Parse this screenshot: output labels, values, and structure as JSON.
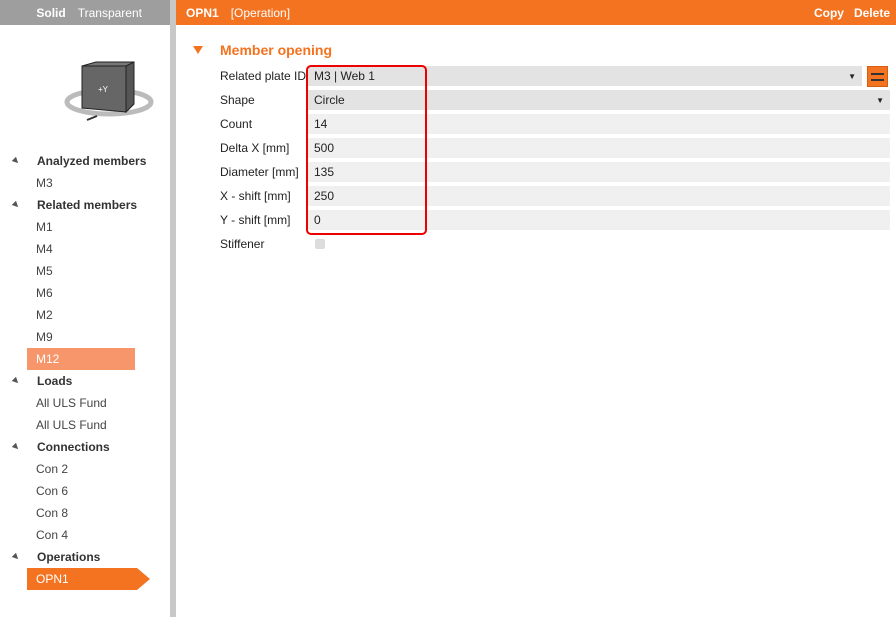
{
  "left_header": {
    "solid": "Solid",
    "transparent": "Transparent"
  },
  "tree": [
    {
      "type": "grp",
      "label": "Analyzed members"
    },
    {
      "type": "leaf",
      "label": "M3"
    },
    {
      "type": "grp",
      "label": "Related members"
    },
    {
      "type": "leaf",
      "label": "M1"
    },
    {
      "type": "leaf",
      "label": "M4"
    },
    {
      "type": "leaf",
      "label": "M5"
    },
    {
      "type": "leaf",
      "label": "M6"
    },
    {
      "type": "leaf",
      "label": "M2"
    },
    {
      "type": "leaf",
      "label": "M9"
    },
    {
      "type": "sel",
      "label": "M12"
    },
    {
      "type": "grp",
      "label": "Loads"
    },
    {
      "type": "leaf",
      "label": "All ULS Fund"
    },
    {
      "type": "leaf",
      "label": "All ULS Fund"
    },
    {
      "type": "grp",
      "label": "Connections"
    },
    {
      "type": "leaf",
      "label": "Con 2"
    },
    {
      "type": "leaf",
      "label": "Con 6"
    },
    {
      "type": "leaf",
      "label": "Con 8"
    },
    {
      "type": "leaf",
      "label": "Con 4"
    },
    {
      "type": "grp",
      "label": "Operations"
    },
    {
      "type": "act",
      "label": "OPN1"
    }
  ],
  "header": {
    "title": "OPN1",
    "subtitle": "[Operation]",
    "copy": "Copy",
    "delete": "Delete"
  },
  "section": {
    "title": "Member opening"
  },
  "fields": {
    "plate": {
      "label": "Related plate ID",
      "value": "M3 | Web 1"
    },
    "shape": {
      "label": "Shape",
      "value": "Circle"
    },
    "count": {
      "label": "Count",
      "value": "14"
    },
    "delta": {
      "label": "Delta X [mm]",
      "value": "500"
    },
    "diameter": {
      "label": "Diameter [mm]",
      "value": "135"
    },
    "xshift": {
      "label": "X - shift [mm]",
      "value": "250"
    },
    "yshift": {
      "label": "Y - shift [mm]",
      "value": "0"
    },
    "stiffener": {
      "label": "Stiffener",
      "checked": false
    }
  },
  "colors": {
    "accent": "#f47321",
    "highlight": "#e00000"
  }
}
